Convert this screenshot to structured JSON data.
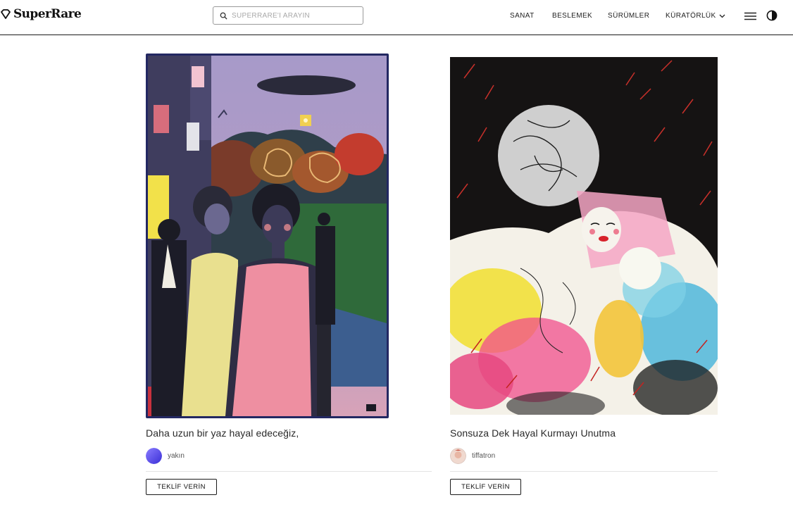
{
  "header": {
    "logo_text": "SuperRare",
    "search_placeholder": "SUPERRARE'İ ARAYIN",
    "nav": {
      "art": "SANAT",
      "feed": "BESLEMEK",
      "releases": "SÜRÜMLER",
      "curation": "KÜRATÖRLÜK"
    }
  },
  "artworks": [
    {
      "title": "Daha uzun bir yaz hayal edeceğiz,",
      "creator": "yakın",
      "button_label": "TEKLİF VERİN"
    },
    {
      "title": "Sonsuza Dek Hayal Kurmayı Unutma",
      "creator": "tiffatron",
      "button_label": "TEKLİF VERİN"
    }
  ]
}
